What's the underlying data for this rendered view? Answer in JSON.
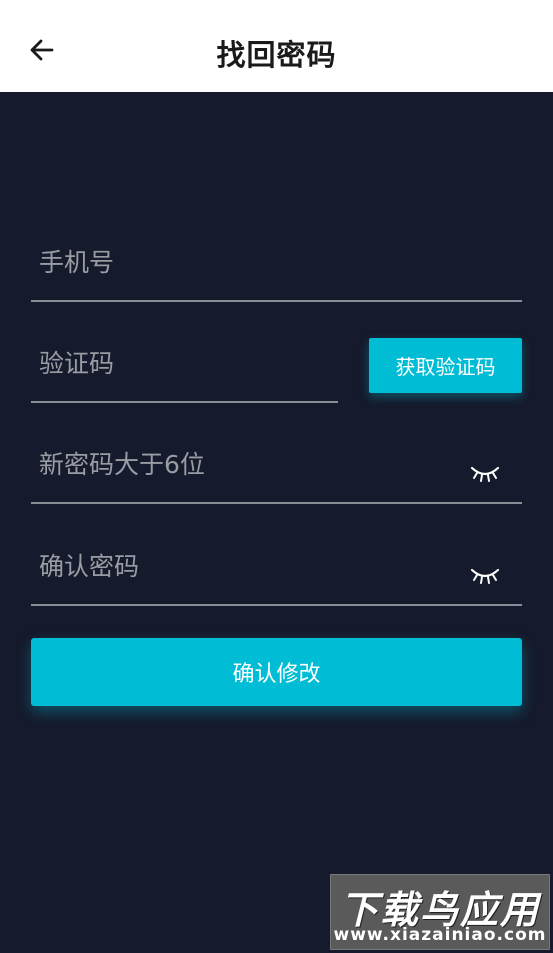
{
  "header": {
    "title": "找回密码"
  },
  "form": {
    "phone_placeholder": "手机号",
    "code_placeholder": "验证码",
    "get_code_label": "获取验证码",
    "new_password_placeholder": "新密码大于6位",
    "confirm_password_placeholder": "确认密码",
    "submit_label": "确认修改"
  },
  "watermark": {
    "title": "下载鸟应用",
    "url": "www.xiazainiao.com"
  },
  "colors": {
    "accent": "#00bcd4",
    "background": "#151a2c",
    "header_bg": "#ffffff",
    "underline": "#8a8d96"
  },
  "icons": {
    "back": "arrow-left-icon",
    "password_toggle": "eye-closed-icon"
  }
}
